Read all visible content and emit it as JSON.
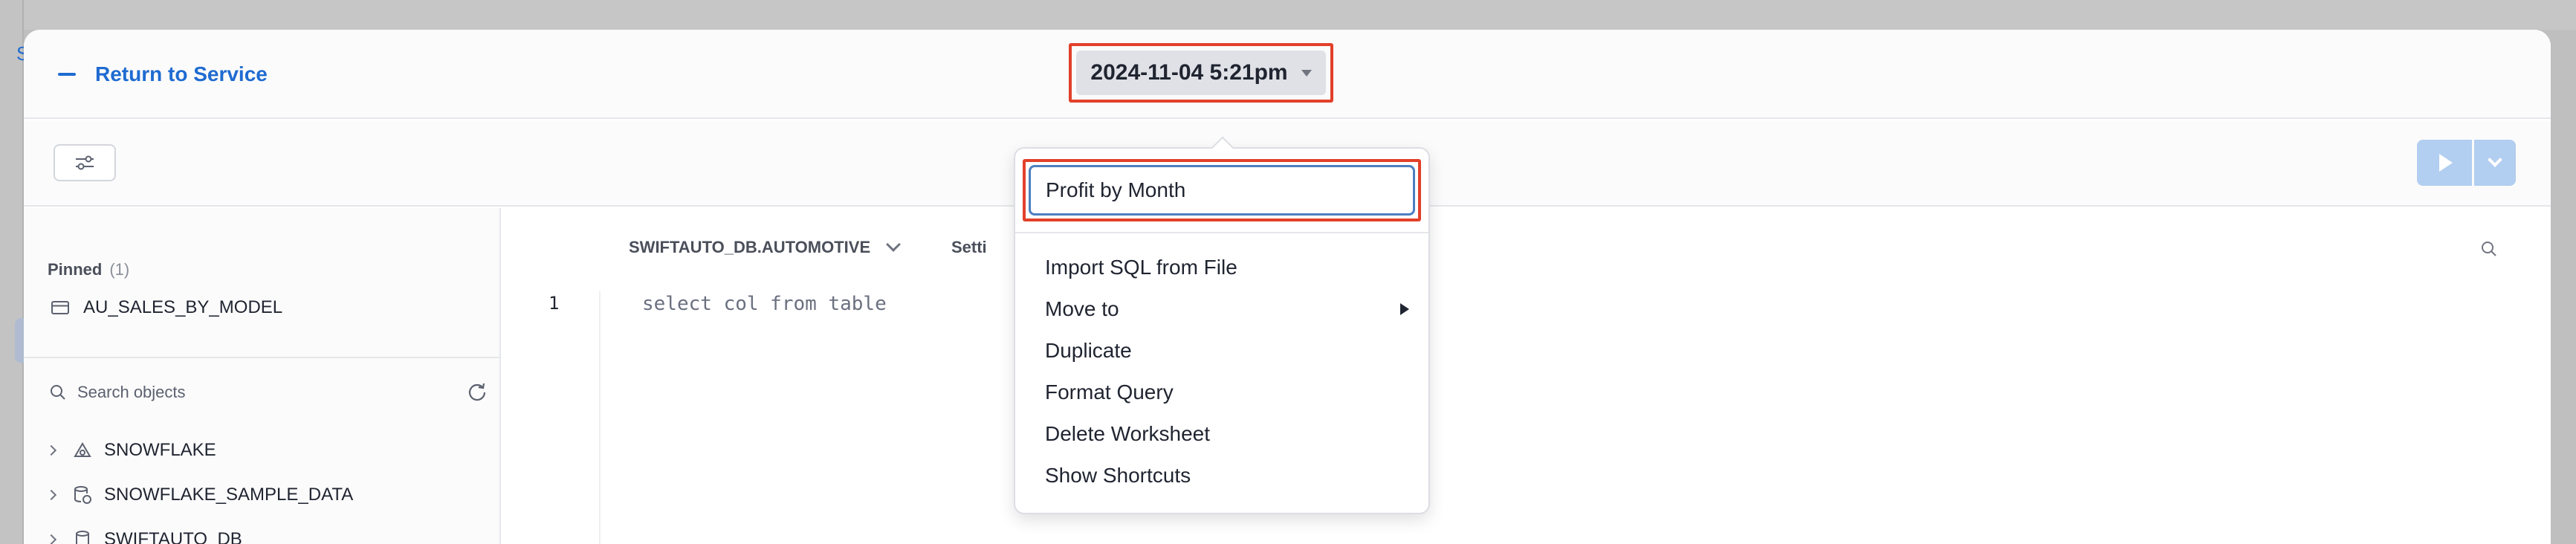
{
  "header": {
    "return_label": "Return to Service",
    "worksheet_title": "2024-11-04 5:21pm"
  },
  "sidebar": {
    "pinned_label": "Pinned",
    "pinned_count": "(1)",
    "pinned_items": [
      {
        "label": "AU_SALES_BY_MODEL",
        "icon": "table-icon"
      }
    ],
    "search_placeholder": "Search objects",
    "databases": [
      {
        "label": "SNOWFLAKE",
        "icon": "snowflake-db-icon"
      },
      {
        "label": "SNOWFLAKE_SAMPLE_DATA",
        "icon": "shared-db-icon"
      },
      {
        "label": "SWIFTAUTO_DB",
        "icon": "database-icon"
      }
    ]
  },
  "editor": {
    "context_label": "SWIFTAUTO_DB.AUTOMOTIVE",
    "settings_label": "Setti",
    "line_number": "1",
    "code": "select col from table"
  },
  "dropdown": {
    "name_value": "Profit by Month",
    "items": [
      {
        "label": "Import SQL from File"
      },
      {
        "label": "Move to"
      },
      {
        "label": "Duplicate"
      },
      {
        "label": "Format Query"
      },
      {
        "label": "Delete Worksheet"
      },
      {
        "label": "Show Shortcuts"
      }
    ]
  },
  "colors": {
    "accent": "#1f6bd1",
    "highlight": "#e2402a",
    "run_button": "#b2cef0"
  }
}
